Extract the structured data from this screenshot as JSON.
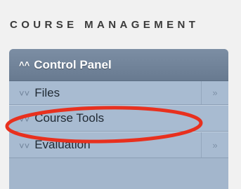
{
  "section": {
    "title": "COURSE MANAGEMENT"
  },
  "control_panel": {
    "header_label": "Control Panel",
    "header_icon": "double-chevron-up-icon",
    "items": [
      {
        "label": "Files",
        "icon": "double-chevron-down-icon",
        "has_expand": true,
        "expand_icon": "double-chevron-right-icon"
      },
      {
        "label": "Course Tools",
        "icon": "double-chevron-down-icon",
        "has_expand": false
      },
      {
        "label": "Evaluation",
        "icon": "double-chevron-down-icon",
        "has_expand": true,
        "expand_icon": "double-chevron-right-icon"
      }
    ]
  },
  "annotation": {
    "shape": "ellipse",
    "color": "#e8301e",
    "target": "Course Tools"
  }
}
